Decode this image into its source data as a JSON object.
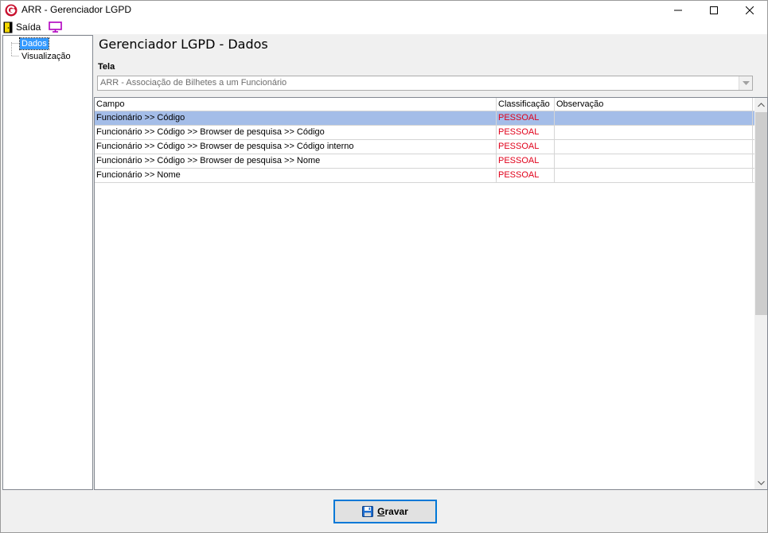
{
  "window": {
    "title": "ARR - Gerenciador LGPD"
  },
  "menu": {
    "exit_label": "Saída",
    "exit_icon": "exit-door-icon",
    "monitor_icon": "monitor-icon"
  },
  "tree": {
    "items": [
      {
        "label": "Dados",
        "selected": true
      },
      {
        "label": "Visualização",
        "selected": false
      }
    ]
  },
  "header": {
    "title": "Gerenciador LGPD - Dados",
    "tela_label": "Tela",
    "tela_value": "ARR - Associação de Bilhetes a um Funcionário"
  },
  "grid": {
    "columns": [
      "Campo",
      "Classificação",
      "Observação"
    ],
    "rows": [
      {
        "campo": "Funcionário >> Código",
        "classificacao": "PESSOAL",
        "observacao": ""
      },
      {
        "campo": "Funcionário >> Código >> Browser de pesquisa >> Código",
        "classificacao": "PESSOAL",
        "observacao": ""
      },
      {
        "campo": "Funcionário >> Código >> Browser de pesquisa >> Código interno",
        "classificacao": "PESSOAL",
        "observacao": ""
      },
      {
        "campo": "Funcionário >> Código >> Browser de pesquisa >> Nome",
        "classificacao": "PESSOAL",
        "observacao": ""
      },
      {
        "campo": "Funcionário >> Nome",
        "classificacao": "PESSOAL",
        "observacao": ""
      }
    ]
  },
  "footer": {
    "save_label_mnemonic": "G",
    "save_label_rest": "ravar"
  },
  "colors": {
    "selected_row": "#a4bde8",
    "classification_text": "#e0001a",
    "tree_selected": "#3399ff"
  }
}
